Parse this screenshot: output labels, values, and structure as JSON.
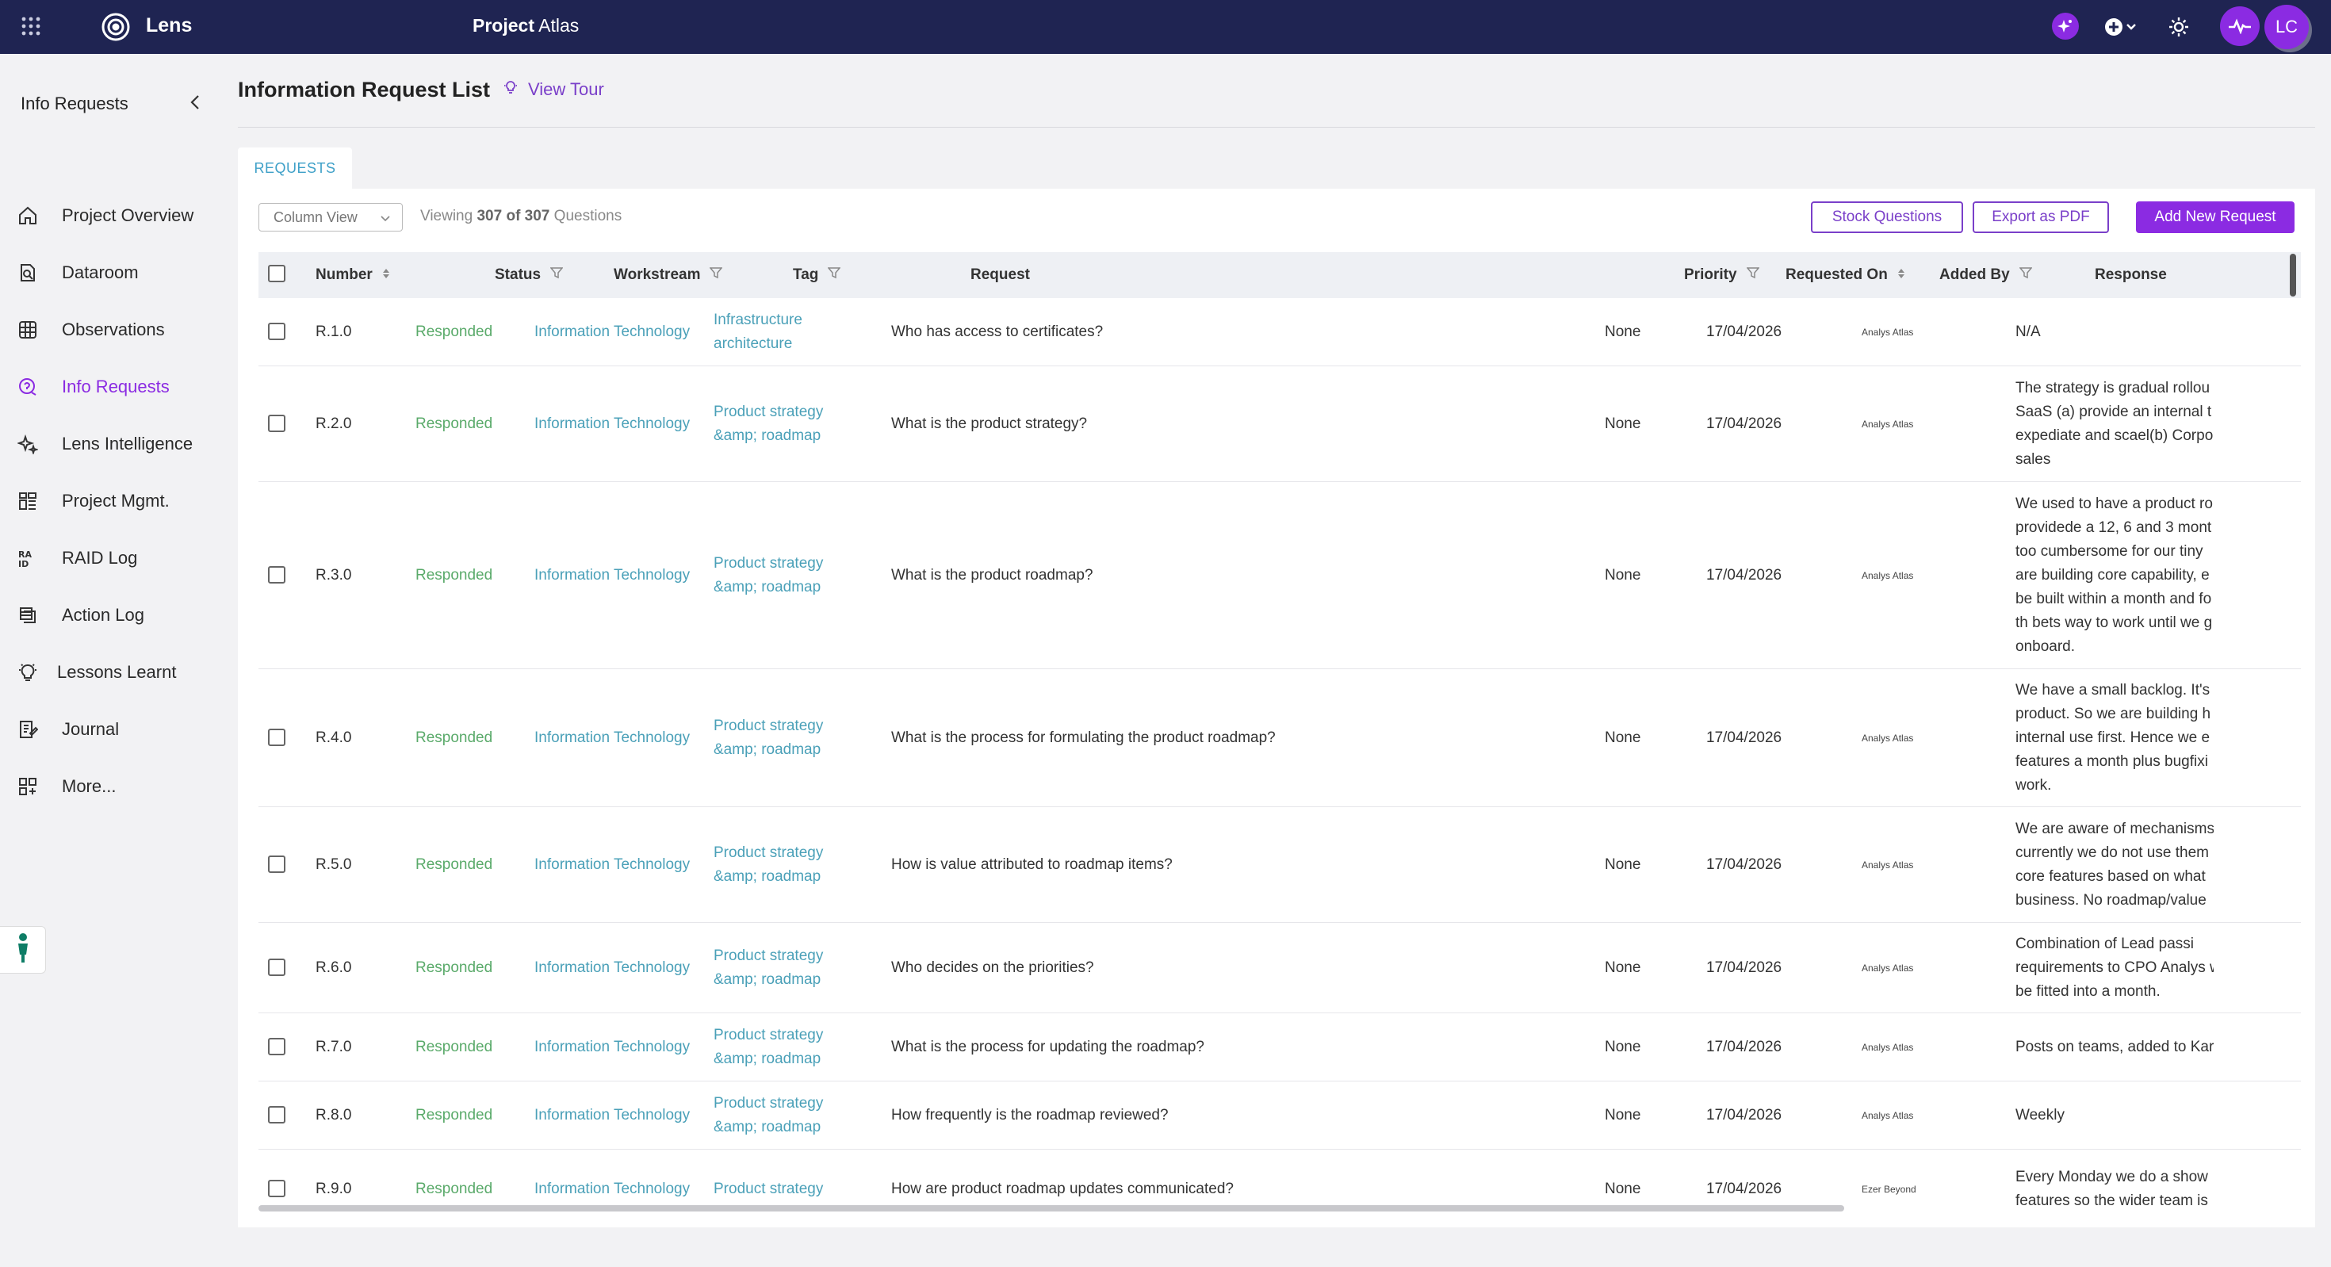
{
  "topbar": {
    "brand": "Lens",
    "project_label": "Project",
    "project_name": "Atlas",
    "avatar_initials": "LC"
  },
  "sidebar": {
    "header": "Info Requests",
    "items": [
      {
        "label": "Project Overview",
        "icon": "home-icon"
      },
      {
        "label": "Dataroom",
        "icon": "document-icon"
      },
      {
        "label": "Observations",
        "icon": "globe-icon"
      },
      {
        "label": "Info Requests",
        "icon": "info-request-icon",
        "active": true
      },
      {
        "label": "Lens Intelligence",
        "icon": "sparkle-icon"
      },
      {
        "label": "Project Mgmt.",
        "icon": "dashboard-icon"
      },
      {
        "label": "RAID Log",
        "icon": "raid-icon"
      },
      {
        "label": "Action Log",
        "icon": "layers-icon"
      },
      {
        "label": "Lessons Learnt",
        "icon": "lightbulb-icon"
      },
      {
        "label": "Journal",
        "icon": "journal-icon"
      },
      {
        "label": "More...",
        "icon": "grid-plus-icon"
      }
    ]
  },
  "page": {
    "title": "Information Request List",
    "view_tour": "View Tour",
    "tab": "REQUESTS"
  },
  "toolbar": {
    "column_view": "Column View",
    "viewing_prefix": "Viewing",
    "viewing_count": "307 of 307",
    "viewing_suffix": "Questions",
    "stock_questions": "Stock Questions",
    "export_pdf": "Export as PDF",
    "add_request": "Add New Request"
  },
  "table": {
    "headers": {
      "number": "Number",
      "status": "Status",
      "workstream": "Workstream",
      "tag": "Tag",
      "request": "Request",
      "priority": "Priority",
      "requested_on": "Requested On",
      "added_by": "Added By",
      "response": "Response"
    },
    "rows": [
      {
        "number": "R.1.0",
        "status": "Responded",
        "workstream": "Information Technology",
        "tag": [
          "Infrastructure",
          "architecture"
        ],
        "request": "Who has access to certificates?",
        "priority": "None",
        "requested_on": "17/04/2026",
        "added_by": "Analys Atlas",
        "response": [
          "N/A"
        ]
      },
      {
        "number": "R.2.0",
        "status": "Responded",
        "workstream": "Information Technology",
        "tag": [
          "Product strategy",
          "&amp; roadmap"
        ],
        "request": "What is the product strategy?",
        "priority": "None",
        "requested_on": "17/04/2026",
        "added_by": "Analys Atlas",
        "response": [
          "The strategy is gradual rollou",
          "SaaS (a) provide an internal t",
          "expediate and scael(b) Corpo",
          "sales"
        ]
      },
      {
        "number": "R.3.0",
        "status": "Responded",
        "workstream": "Information Technology",
        "tag": [
          "Product strategy",
          "&amp; roadmap"
        ],
        "request": "What is the product roadmap?",
        "priority": "None",
        "requested_on": "17/04/2026",
        "added_by": "Analys Atlas",
        "response": [
          "We used to have a product ro",
          "providede a 12, 6 and 3 mont",
          "too cumbersome for our tiny",
          "are building core capability, e",
          "be built within a month and fo",
          "th bets way to work until we g",
          "onboard."
        ]
      },
      {
        "number": "R.4.0",
        "status": "Responded",
        "workstream": "Information Technology",
        "tag": [
          "Product strategy",
          "&amp; roadmap"
        ],
        "request": "What is the process for formulating the product roadmap?",
        "priority": "None",
        "requested_on": "17/04/2026",
        "added_by": "Analys Atlas",
        "response": [
          "We have a small backlog. It's",
          "product. So we are building h",
          "internal use first. Hence we e",
          "features a month plus bugfixi",
          "work."
        ]
      },
      {
        "number": "R.5.0",
        "status": "Responded",
        "workstream": "Information Technology",
        "tag": [
          "Product strategy",
          "&amp; roadmap"
        ],
        "request": "How is value attributed to roadmap items?",
        "priority": "None",
        "requested_on": "17/04/2026",
        "added_by": "Analys Atlas",
        "response": [
          "We are aware of mechanisms",
          "currently we do not use them",
          "core features based on what",
          "business. No roadmap/value"
        ]
      },
      {
        "number": "R.6.0",
        "status": "Responded",
        "workstream": "Information Technology",
        "tag": [
          "Product strategy",
          "&amp; roadmap"
        ],
        "request": "Who decides on the priorities?",
        "priority": "None",
        "requested_on": "17/04/2026",
        "added_by": "Analys Atlas",
        "response": [
          "Combination of Lead passi",
          "requirements to CPO Analys wh",
          "be fitted into a month."
        ]
      },
      {
        "number": "R.7.0",
        "status": "Responded",
        "workstream": "Information Technology",
        "tag": [
          "Product strategy",
          "&amp; roadmap"
        ],
        "request": "What is the process for updating the roadmap?",
        "priority": "None",
        "requested_on": "17/04/2026",
        "added_by": "Analys Atlas",
        "response": [
          "Posts on teams, added to Kar"
        ]
      },
      {
        "number": "R.8.0",
        "status": "Responded",
        "workstream": "Information Technology",
        "tag": [
          "Product strategy",
          "&amp; roadmap"
        ],
        "request": "How frequently is the roadmap reviewed?",
        "priority": "None",
        "requested_on": "17/04/2026",
        "added_by": "Analys Atlas",
        "response": [
          "Weekly"
        ]
      },
      {
        "number": "R.9.0",
        "status": "Responded",
        "workstream": "Information Technology",
        "tag": [
          "Product strategy"
        ],
        "request": "How are product roadmap updates communicated?",
        "priority": "None",
        "requested_on": "17/04/2026",
        "added_by": "Ezer Beyond",
        "response": [
          "Every Monday we do a show",
          "features so the wider team is"
        ]
      }
    ]
  },
  "colors": {
    "topbar_bg": "#1f2452",
    "accent": "#8b2be2",
    "status_green": "#5aaa6a",
    "link_teal": "#4aa0b8"
  }
}
